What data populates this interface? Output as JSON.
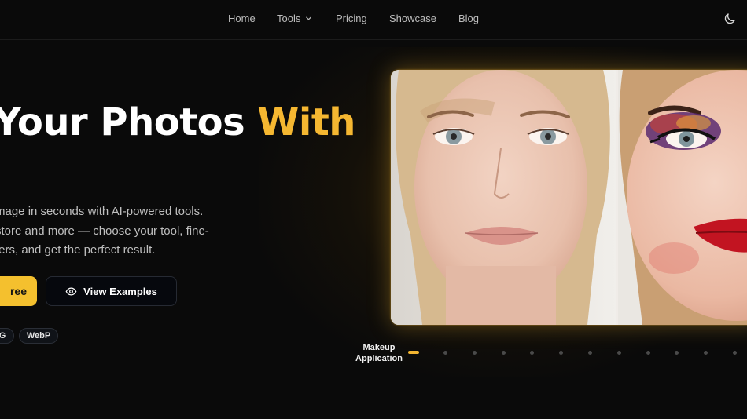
{
  "nav": {
    "items": [
      "Home",
      "Tools",
      "Pricing",
      "Showcase",
      "Blog"
    ],
    "tools_has_dropdown": true,
    "theme_toggle_icon": "moon-icon"
  },
  "hero": {
    "headline_main": "Your Photos ",
    "headline_accent": "With",
    "accent_color": "#f5b731",
    "description_lines": [
      "mage in seconds with AI-powered tools.",
      "store and more — choose your tool, fine-",
      "ters, and get the perfect result."
    ],
    "primary_button": "ree",
    "secondary_button": "View Examples",
    "secondary_button_icon": "eye-icon",
    "format_badges": [
      "G",
      "WebP"
    ]
  },
  "showcase": {
    "caption_line1": "Makeup",
    "caption_line2": "Application",
    "active_dot_index": 0,
    "dot_count": 13,
    "active_color": "#f2b531"
  }
}
